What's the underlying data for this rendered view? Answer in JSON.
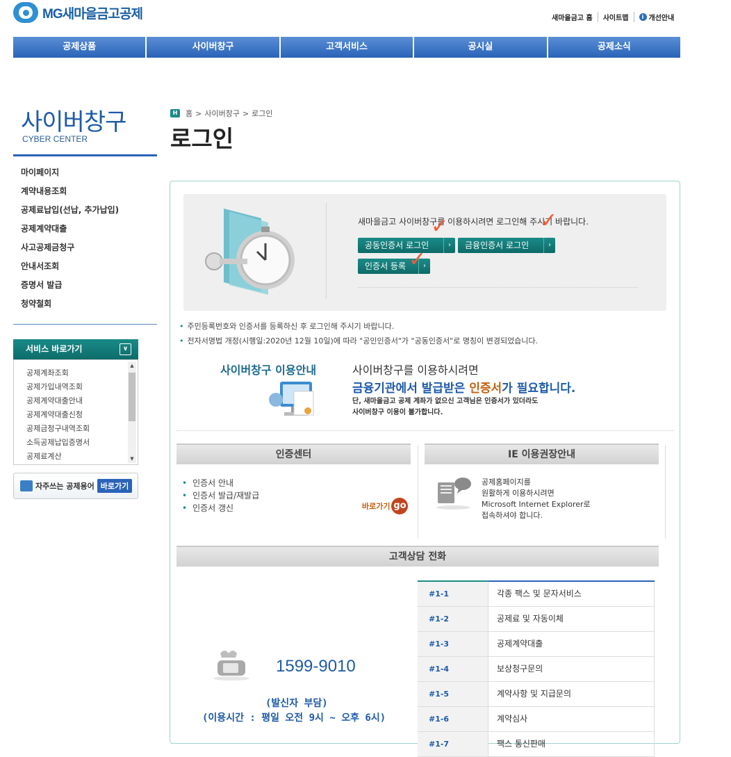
{
  "header": {
    "logo_text": "MG새마을금고공제",
    "util": [
      "새마을금고 홈",
      "사이트맵",
      "개선안내"
    ],
    "info_icon": "i"
  },
  "gnb": [
    "공제상품",
    "사이버창구",
    "고객서비스",
    "공시실",
    "공제소식"
  ],
  "lnb": {
    "title": "사이버창구",
    "subtitle": "CYBER CENTER",
    "items": [
      "마이페이지",
      "계약내용조회",
      "공제료납입(선납, 추가납입)",
      "공제계약대출",
      "사고공제금청구",
      "안내서조회",
      "증명서 발급",
      "청약철회"
    ]
  },
  "service_shortcuts": {
    "title": "서비스 바로가기",
    "toggle": "∨",
    "items": [
      "공제계좌조회",
      "공제가입내역조회",
      "공제계약대출안내",
      "공제계약대출신청",
      "공제금청구내역조회",
      "소득공제납입증명서",
      "공제료계산"
    ]
  },
  "glossary": {
    "label": "자주쓰는 공제용어",
    "button": "바로가기"
  },
  "breadcrumb": {
    "home_icon": "H",
    "items": [
      "홈",
      "사이버창구",
      "로그인"
    ],
    "sep": ">"
  },
  "page_title": "로그인",
  "login": {
    "message": "새마을금고 사이버창구를 이용하시려면 로그인해 주시기 바랍니다.",
    "buttons": [
      "공동인증서 로그인",
      "금융인증서 로그인",
      "인증서 등록"
    ],
    "arrow": "›"
  },
  "notes": [
    "주민등록번호와 인증서를 등록하신 후 로그인해 주시기 바랍니다.",
    "전자서명법 개정(시행일:2020년 12월 10일)에 따라 \"공인인증서\"가 \"공동인증서\"로 명칭이 변경되었습니다."
  ],
  "guide": {
    "title": "사이버창구 이용안내",
    "line1": "사이버창구를 이용하시려면",
    "line2_a": "금융기관에서 발급받은 ",
    "line2_b": "인증서",
    "line2_c": "가 필요합니다.",
    "note1": "단, 새마을금고 공제 계좌가 없으신 고객님은 인증서가 있더라도",
    "note2": "사이버창구 이용이 불가합니다."
  },
  "cert_center": {
    "title": "인증센터",
    "items": [
      "인증서 안내",
      "인증서 발급/재발급",
      "인증서 갱신"
    ],
    "goto": "바로가기",
    "go": "go"
  },
  "ie_guide": {
    "title": "IE 이용권장안내",
    "lines": [
      "공제홈페이지를",
      "원활하게 이용하시려면",
      "Microsoft Internet Explorer로",
      "접속하셔야 합니다."
    ]
  },
  "call_center": {
    "title": "고객상담 전화",
    "phone": "1599-9010",
    "payer": "(발신자 부담)",
    "hours": "(이용시간 : 평일 오전 9시 ~ 오후 6시)",
    "menu": [
      {
        "code": "#1-1",
        "desc": "각종 팩스 및 문자서비스"
      },
      {
        "code": "#1-2",
        "desc": "공제료 및 자동이체"
      },
      {
        "code": "#1-3",
        "desc": "공제계약대출"
      },
      {
        "code": "#1-4",
        "desc": "보상청구문의"
      },
      {
        "code": "#1-5",
        "desc": "계약사항 및 지급문의"
      },
      {
        "code": "#1-6",
        "desc": "계약심사"
      },
      {
        "code": "#1-7",
        "desc": "팩스 통신판매"
      }
    ]
  },
  "annotations": {
    "check_mark": "✓",
    "check_color": "#ef5a3a"
  },
  "colors": {
    "primary": "#2a63b8",
    "teal": "#1a8b88",
    "accent": "#c4600e"
  }
}
